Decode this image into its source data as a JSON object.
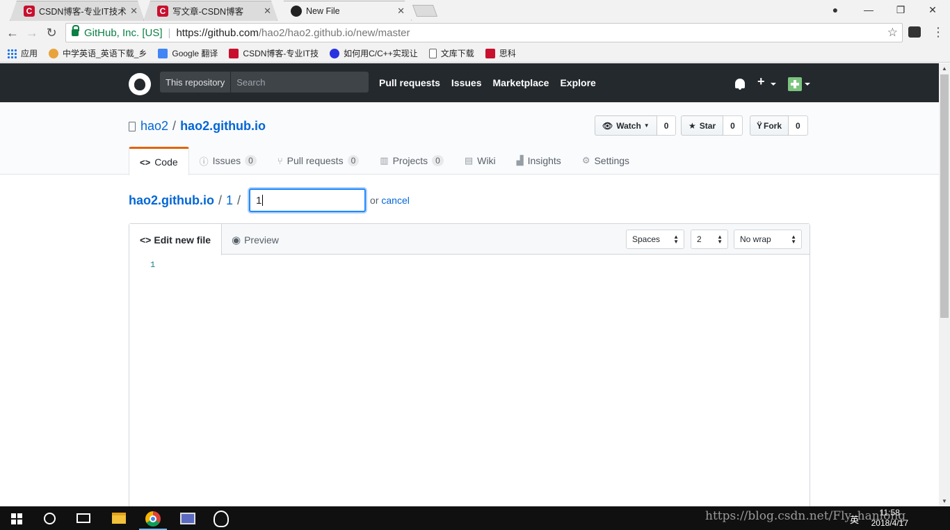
{
  "browser": {
    "tabs": [
      {
        "title": "CSDN博客-专业IT技术发",
        "favicon": "csdn-icon",
        "active": false
      },
      {
        "title": "写文章-CSDN博客",
        "favicon": "csdn-icon",
        "active": false
      },
      {
        "title": "New File",
        "favicon": "github-icon",
        "active": true
      }
    ],
    "tab_close": "✕",
    "window_controls": {
      "minimize": "—",
      "restore": "❐",
      "close": "✕"
    },
    "address": {
      "ev_label": "GitHub, Inc. [US]",
      "scheme_host": "https://github.com",
      "path": "/hao2/hao2.github.io/new/master"
    },
    "bookmarks": [
      {
        "label": "应用",
        "icon": "apps-icon"
      },
      {
        "label": "中学英语_英语下载_乡",
        "icon": "bookmark-icon"
      },
      {
        "label": "Google 翻译",
        "icon": "google-translate-icon"
      },
      {
        "label": "CSDN博客-专业IT技",
        "icon": "csdn-icon"
      },
      {
        "label": "如何用C/C++实现让",
        "icon": "baidu-icon"
      },
      {
        "label": "文库下载",
        "icon": "page-icon"
      },
      {
        "label": "思科",
        "icon": "csdn-icon"
      }
    ]
  },
  "github": {
    "search_scope": "This repository",
    "search_placeholder": "Search",
    "nav": [
      "Pull requests",
      "Issues",
      "Marketplace",
      "Explore"
    ],
    "repo": {
      "owner": "hao2",
      "name": "hao2.github.io"
    },
    "actions": [
      {
        "label": "Watch",
        "count": "0",
        "icon": "eye-icon"
      },
      {
        "label": "Star",
        "count": "0",
        "icon": "star-icon"
      },
      {
        "label": "Fork",
        "count": "0",
        "icon": "fork-icon"
      }
    ],
    "repo_nav": [
      {
        "label": "Code",
        "icon": "code-icon",
        "counter": null,
        "selected": true
      },
      {
        "label": "Issues",
        "icon": "issue-icon",
        "counter": "0",
        "selected": false
      },
      {
        "label": "Pull requests",
        "icon": "pull-request-icon",
        "counter": "0",
        "selected": false
      },
      {
        "label": "Projects",
        "icon": "project-icon",
        "counter": "0",
        "selected": false
      },
      {
        "label": "Wiki",
        "icon": "book-icon",
        "counter": null,
        "selected": false
      },
      {
        "label": "Insights",
        "icon": "graph-icon",
        "counter": null,
        "selected": false
      },
      {
        "label": "Settings",
        "icon": "gear-icon",
        "counter": null,
        "selected": false
      }
    ],
    "breadcrumb": {
      "root": "hao2.github.io",
      "dir": "1",
      "separator": "/"
    },
    "filename_value": "1",
    "or_text": "or",
    "cancel_label": "cancel",
    "editor": {
      "tab_edit": "Edit new file",
      "tab_preview": "Preview",
      "indent_mode": "Spaces",
      "indent_size": "2",
      "wrap_mode": "No wrap",
      "line_numbers": [
        "1"
      ]
    }
  },
  "taskbar": {
    "apps": [
      "windows-start-icon",
      "cortana-icon",
      "task-view-icon",
      "file-explorer-icon",
      "chrome-icon",
      "photos-icon",
      "qq-icon"
    ],
    "ime": "英",
    "time": "11:58",
    "date": "2018/4/17",
    "watermark": "https://blog.csdn.net/Fly_hanlong"
  }
}
